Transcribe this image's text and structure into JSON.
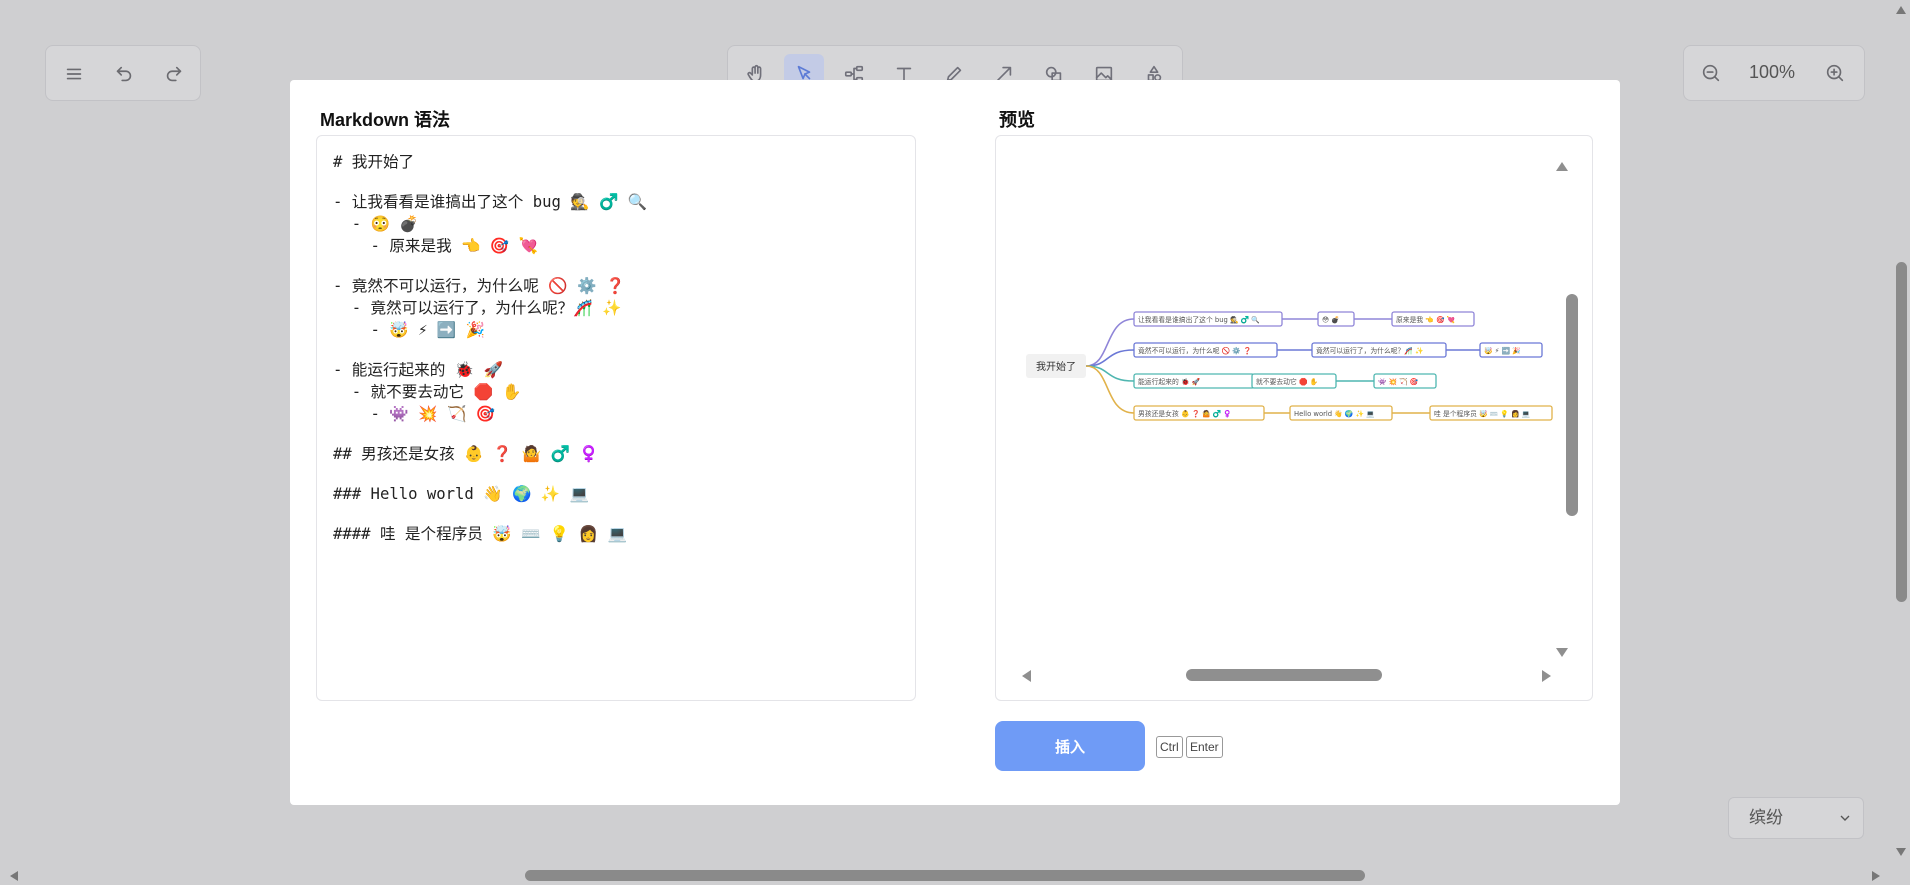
{
  "toolbar_left": {
    "menu_icon": "menu-icon",
    "undo_icon": "undo-icon",
    "redo_icon": "redo-icon"
  },
  "toolbar_center": {
    "tools": [
      "hand-icon",
      "pointer-icon",
      "mindmap-icon",
      "text-icon",
      "pencil-icon",
      "arrow-icon",
      "shape-icon",
      "image-icon",
      "extra-tools-icon"
    ],
    "active_tool": "pointer-icon"
  },
  "zoom": {
    "value": "100%"
  },
  "theme": {
    "selected": "缤纷"
  },
  "modal": {
    "left_title": "Markdown 语法",
    "right_title": "预览",
    "insert_label": "插入",
    "shortcut": [
      "Ctrl",
      "Enter"
    ],
    "markdown_lines": [
      "# 我开始了",
      "",
      "- 让我看看是谁搞出了这个 bug 🕵️ ♂️ 🔍",
      "  - 😳 💣",
      "    - 原来是我 👈 🎯 💘",
      "",
      "- 竟然不可以运行，为什么呢 🚫 ⚙️ ❓",
      "  - 竟然可以运行了，为什么呢？🎢 ✨",
      "    - 🤯 ⚡ ➡️ 🎉",
      "",
      "- 能运行起来的 🐞 🚀",
      "  - 就不要去动它 🛑 ✋",
      "    - 👾 💥 🏹 🎯",
      "",
      "## 男孩还是女孩 👶 ❓ 🤷 ♂️ ♀️",
      "",
      "### Hello world 👋 🌍 ✨ 💻",
      "",
      "#### 哇 是个程序员 🤯 ⌨️ 💡 👩 💻"
    ]
  },
  "mindmap": {
    "root": "我开始了",
    "colors": [
      "#8f85d8",
      "#6b78d6",
      "#4fb6b0",
      "#e1b24a"
    ],
    "branches": [
      [
        "让我看看是谁搞出了这个 bug 🕵️ ♂️ 🔍",
        "😳 💣",
        "原来是我 👈 🎯 💘"
      ],
      [
        "竟然不可以运行，为什么呢 🚫 ⚙️ ❓",
        "竟然可以运行了，为什么呢？🎢 ✨",
        "🤯 ⚡ ➡️ 🎉"
      ],
      [
        "能运行起来的 🐞 🚀",
        "就不要去动它 🛑 ✋",
        "👾 💥 🏹 🎯"
      ],
      [
        "男孩还是女孩 👶 ❓ 🤷 ♂️ ♀️",
        "Hello world 👋 🌍 ✨ 💻",
        "哇 是个程序员 🤯 ⌨️ 💡 👩 💻"
      ]
    ]
  }
}
